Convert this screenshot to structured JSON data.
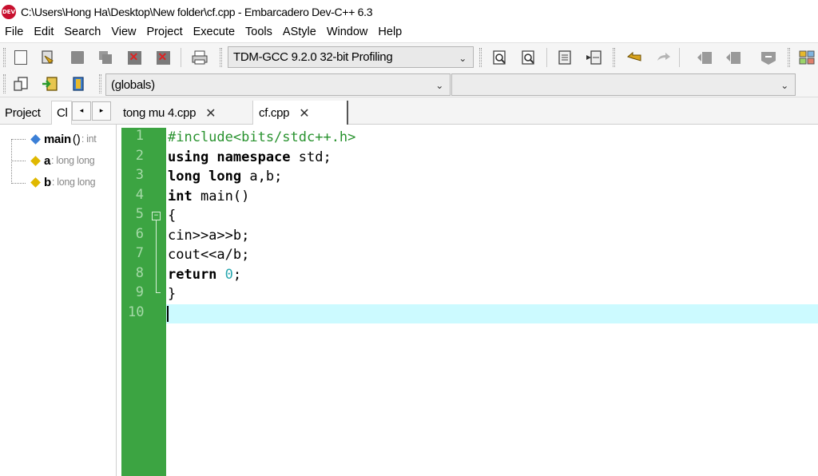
{
  "window": {
    "title": "C:\\Users\\Hong Ha\\Desktop\\New folder\\cf.cpp - Embarcadero Dev-C++ 6.3",
    "app_icon_label": "DEV"
  },
  "menu": [
    "File",
    "Edit",
    "Search",
    "View",
    "Project",
    "Execute",
    "Tools",
    "AStyle",
    "Window",
    "Help"
  ],
  "toolbar": {
    "compiler": "TDM-GCC 9.2.0 32-bit Profiling",
    "scope": "(globals)",
    "member": ""
  },
  "left_panel": {
    "tabs": [
      "Project",
      "Cl"
    ],
    "symbols": [
      {
        "name": "main",
        "signature": "()",
        "type": ": int",
        "color": "#3b7fd6"
      },
      {
        "name": "a",
        "signature": "",
        "type": ": long long",
        "color": "#e0b800"
      },
      {
        "name": "b",
        "signature": "",
        "type": ": long long",
        "color": "#e0b800"
      }
    ]
  },
  "editor_tabs": [
    {
      "label": "tong mu 4.cpp",
      "close": "✕"
    },
    {
      "label": "cf.cpp",
      "close": "✕"
    }
  ],
  "gutter": {
    "line_numbers": [
      "1",
      "2",
      "3",
      "4",
      "5",
      "6",
      "7",
      "8",
      "9",
      "10"
    ],
    "fold_marker": "−"
  },
  "code": {
    "l1": "#include<bits/stdc++.h>",
    "l2_kw": "using namespace",
    "l2_rest": " std;",
    "l3_kw": "long long",
    "l3_rest": " a,b;",
    "l4_kw": "int",
    "l4_rest": " main()",
    "l5": "{",
    "l6": "cin>>a>>b;",
    "l7": "cout<<a/b;",
    "l8_kw": "return",
    "l8_num": "0",
    "l8_rest": ";",
    "l9": "}"
  },
  "colors": {
    "gutter": "#3ca442",
    "current_line": "#ccfaff",
    "preprocessor": "#28922e",
    "number": "#2aa8b0"
  }
}
